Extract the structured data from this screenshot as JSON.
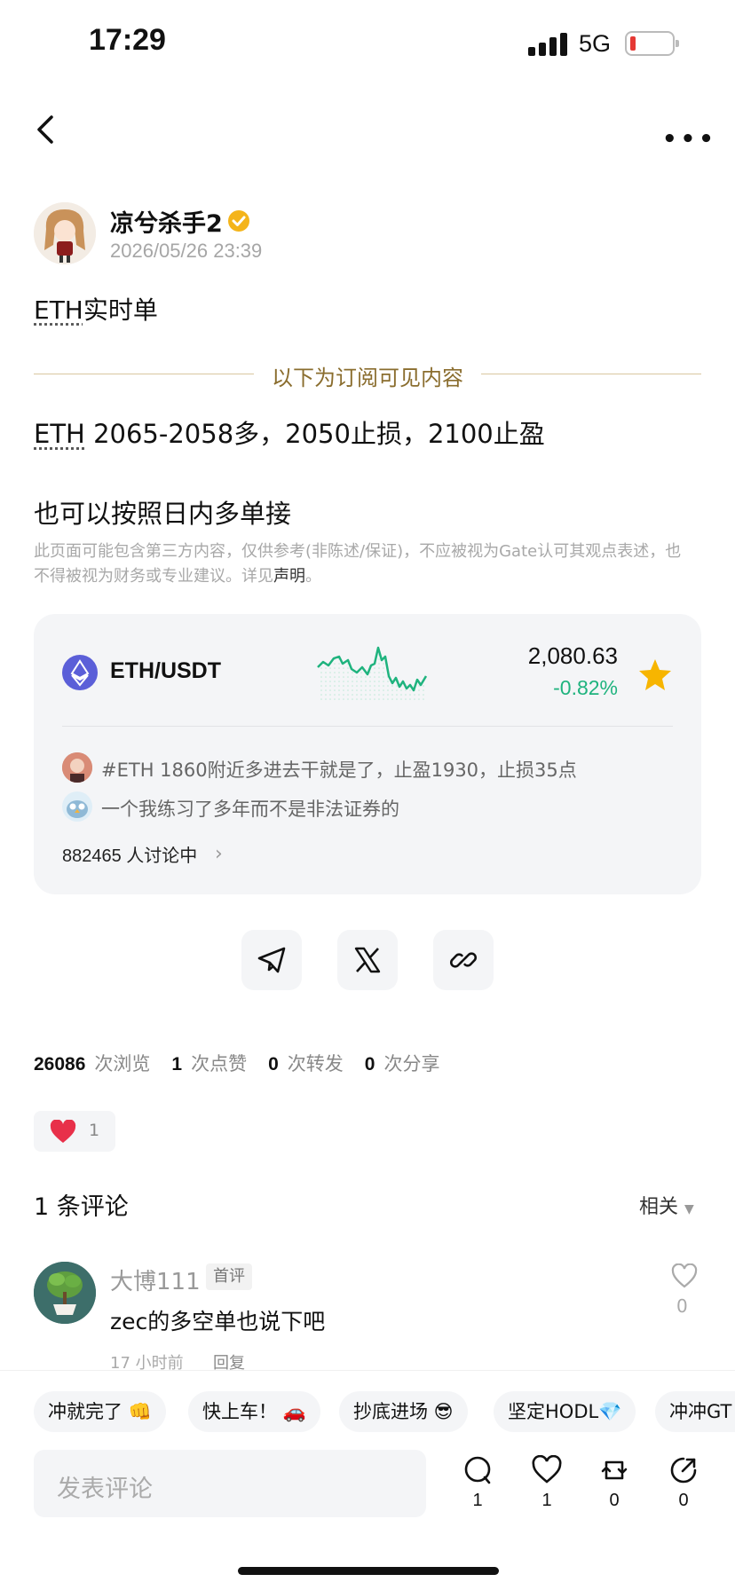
{
  "status_bar": {
    "time": "17:29",
    "network": "5G"
  },
  "author": {
    "name": "凉兮杀手2",
    "time": "2026/05/26 23:39"
  },
  "post": {
    "title_ticker": "ETH",
    "title_rest": "实时单",
    "divider_label": "以下为订阅可见内容",
    "trade_ticker": "ETH",
    "trade_rest": " 2065-2058多，2050止损，2100止盈",
    "line2": "也可以按照日内多单接",
    "disclaimer": "此页面可能包含第三方内容，仅供参考(非陈述/保证)，不应被视为Gate认可其观点表述，也不得被视为财务或专业建议。详见",
    "disclaimer_link": "声明",
    "disclaimer_end": "。"
  },
  "market_card": {
    "pair": "ETH/USDT",
    "price": "2,080.63",
    "change": "-0.82%",
    "feed": [
      "#ETH 1860附近多进去干就是了，止盈1930，止损35点",
      "一个我练习了多年而不是非法证券的"
    ],
    "discussing": "882465 人讨论中",
    "chevron": "›",
    "colors": {
      "up": "#1fb37e",
      "star": "#f7b500",
      "eth": "#5b5fd8"
    }
  },
  "share_buttons": [
    "telegram-icon",
    "x-icon",
    "link-icon"
  ],
  "stats": {
    "views": "26086",
    "views_label": "次浏览",
    "likes": "1",
    "likes_label": "次点赞",
    "reposts": "0",
    "reposts_label": "次转发",
    "shares": "0",
    "shares_label": "次分享"
  },
  "reaction": {
    "emoji": "heart",
    "count": "1"
  },
  "comments_header": {
    "count": "1 条评论",
    "sort": "相关"
  },
  "comment": {
    "user": "大博111",
    "badge": "首评",
    "text": "zec的多空单也说下吧",
    "time": "17 小时前",
    "reply": "回复",
    "likes": "0"
  },
  "quick_chips": [
    "冲就完了 👊",
    "快上车！ 🚗",
    "抄底进场 😎",
    "坚定HODL💎",
    "冲冲GT"
  ],
  "composer": {
    "placeholder": "发表评论",
    "actions": [
      {
        "icon": "comment-icon",
        "count": "1"
      },
      {
        "icon": "heart-icon",
        "count": "1"
      },
      {
        "icon": "repost-icon",
        "count": "0"
      },
      {
        "icon": "share-icon",
        "count": "0"
      }
    ]
  }
}
